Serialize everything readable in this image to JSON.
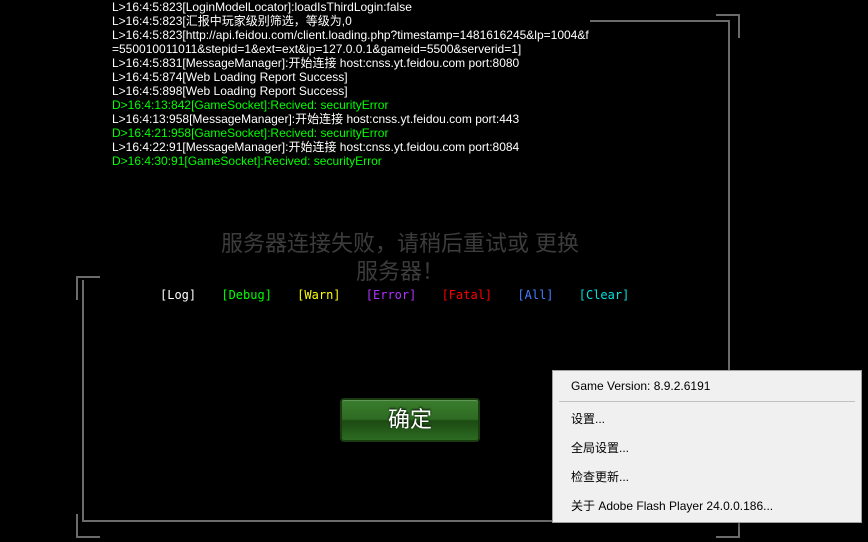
{
  "console": {
    "lines": [
      {
        "cls": "white",
        "text": "L>16:4:5:823[LoginModelLocator]:loadIsThirdLogin:false"
      },
      {
        "cls": "white",
        "text": "L>16:4:5:823[汇报中玩家级别筛选，等级为,0"
      },
      {
        "cls": "white",
        "text": "L>16:4:5:823[http://api.feidou.com/client.loading.php?timestamp=1481616245&lp=1004&f=550010011011&stepid=1&ext=ext&ip=127.0.0.1&gameid=5500&serverid=1]"
      },
      {
        "cls": "white",
        "text": "L>16:4:5:831[MessageManager]:开始连接 host:cnss.yt.feidou.com port:8080"
      },
      {
        "cls": "white",
        "text": "L>16:4:5:874[Web Loading Report Success]"
      },
      {
        "cls": "white",
        "text": "L>16:4:5:898[Web Loading Report Success]"
      },
      {
        "cls": "warn",
        "text": "D>16:4:13:842[GameSocket]:Recived: securityError"
      },
      {
        "cls": "white",
        "text": "L>16:4:13:958[MessageManager]:开始连接 host:cnss.yt.feidou.com port:443"
      },
      {
        "cls": "warn",
        "text": "D>16:4:21:958[GameSocket]:Recived: securityError"
      },
      {
        "cls": "white",
        "text": "L>16:4:22:91[MessageManager]:开始连接 host:cnss.yt.feidou.com port:8084"
      },
      {
        "cls": "warn",
        "text": "D>16:4:30:91[GameSocket]:Recived: securityError"
      }
    ]
  },
  "filters": {
    "log": {
      "label": "[Log]",
      "color": "#ffffff"
    },
    "debug": {
      "label": "[Debug]",
      "color": "#00ff00"
    },
    "warn": {
      "label": "[Warn]",
      "color": "#ffff00"
    },
    "error": {
      "label": "[Error]",
      "color": "#b030ff"
    },
    "fatal": {
      "label": "[Fatal]",
      "color": "#ff0000"
    },
    "all": {
      "label": "[All]",
      "color": "#4080ff"
    },
    "clear": {
      "label": "[Clear]",
      "color": "#00e0e0"
    }
  },
  "shadow_message": "服务器连接失败，请稍后重试或\n更换服务器！",
  "ok_button_label": "确定",
  "context_menu": {
    "header": "Game Version: 8.9.2.6191",
    "items": [
      "设置...",
      "全局设置...",
      "检查更新...",
      "关于 Adobe Flash Player 24.0.0.186..."
    ]
  }
}
